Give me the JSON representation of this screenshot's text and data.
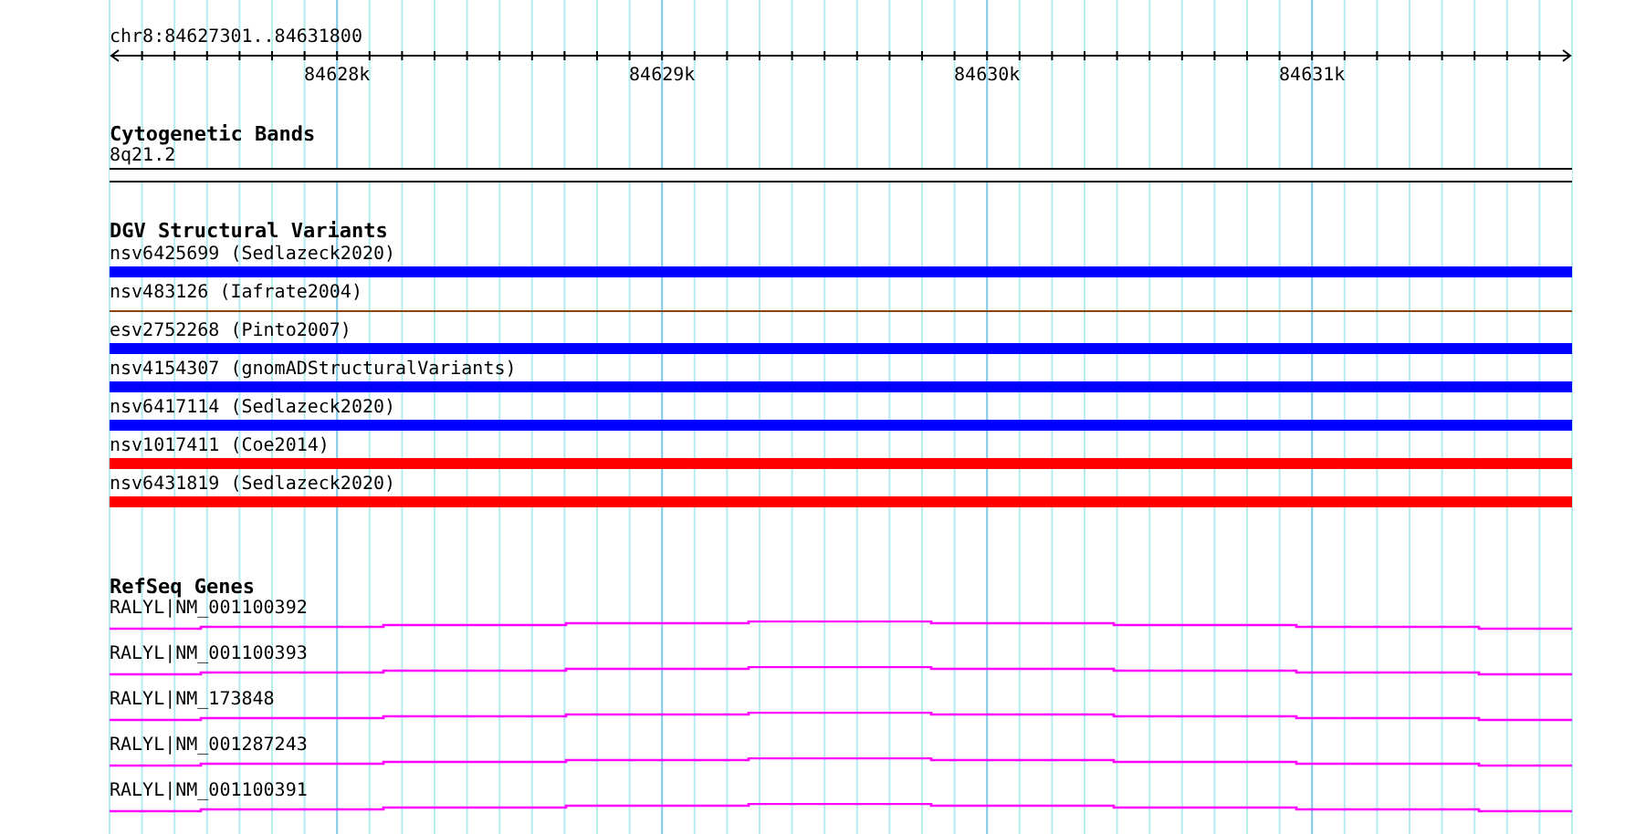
{
  "ruler": {
    "range": "chr8:84627301..84631800",
    "labels": [
      "84628k",
      "84629k",
      "84630k",
      "84631k"
    ]
  },
  "tracks": [
    {
      "kind": "cytoband",
      "title": "Cytogenetic Bands",
      "features": [
        {
          "label": "8q21.2"
        }
      ]
    },
    {
      "kind": "variants",
      "title": "DGV Structural Variants",
      "features": [
        {
          "label": "nsv6425699 (Sedlazeck2020)",
          "color": "#0000ff",
          "thick": true
        },
        {
          "label": "nsv483126 (Iafrate2004)",
          "color": "#8b4513",
          "thick": false
        },
        {
          "label": "esv2752268 (Pinto2007)",
          "color": "#0000ff",
          "thick": true
        },
        {
          "label": "nsv4154307 (gnomADStructuralVariants)",
          "color": "#0000ff",
          "thick": true
        },
        {
          "label": "nsv6417114 (Sedlazeck2020)",
          "color": "#0000ff",
          "thick": true
        },
        {
          "label": "nsv1017411 (Coe2014)",
          "color": "#ff0000",
          "thick": true
        },
        {
          "label": "nsv6431819 (Sedlazeck2020)",
          "color": "#ff0000",
          "thick": true
        }
      ]
    },
    {
      "kind": "genes",
      "title": "RefSeq Genes",
      "features": [
        {
          "label": "RALYL|NM_001100392"
        },
        {
          "label": "RALYL|NM_001100393"
        },
        {
          "label": "RALYL|NM_173848"
        },
        {
          "label": "RALYL|NM_001287243"
        },
        {
          "label": "RALYL|NM_001100391"
        }
      ]
    }
  ]
}
